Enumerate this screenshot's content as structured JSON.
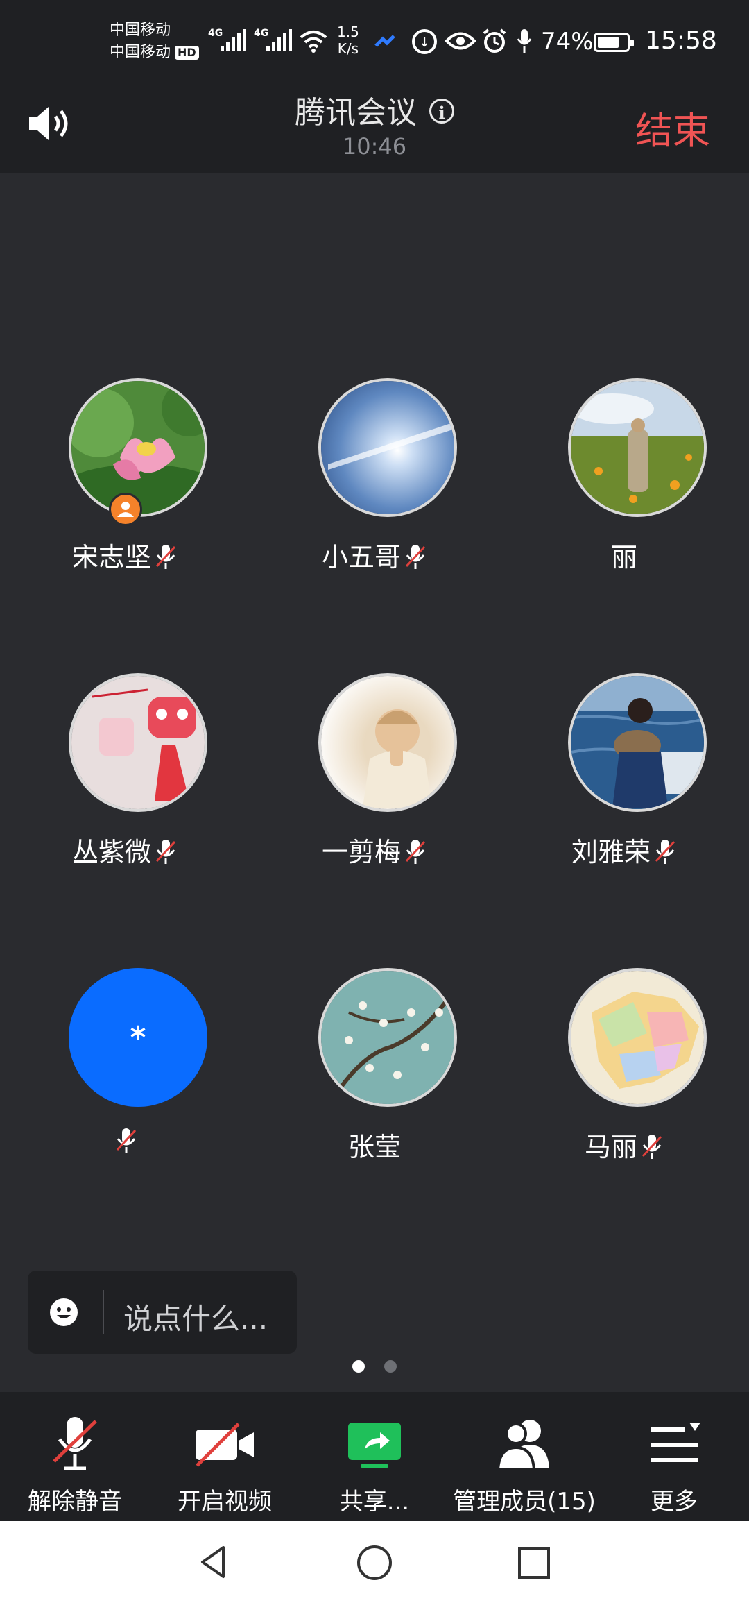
{
  "status_bar": {
    "carrier1": "中国移动",
    "carrier2": "中国移动",
    "hd_badge": "HD",
    "net1": "4G",
    "net2": "4G",
    "speed_value": "1.5",
    "speed_unit": "K/s",
    "battery_pct": "74%",
    "battery_level": 0.74,
    "time": "15:58"
  },
  "header": {
    "title": "腾讯会议",
    "info_glyph": "i",
    "timer": "10:46",
    "end_label": "结束"
  },
  "participants": [
    {
      "name": "宋志坚",
      "muted": true,
      "host": true,
      "avatar": "pink-lotus-photo"
    },
    {
      "name": "小五哥",
      "muted": true,
      "host": false,
      "avatar": "sun-sky-photo"
    },
    {
      "name": "丽",
      "muted": false,
      "host": false,
      "avatar": "flower-field-photo"
    },
    {
      "name": "丛紫微",
      "muted": true,
      "host": false,
      "avatar": "lion-ornament-photo"
    },
    {
      "name": "一剪梅",
      "muted": true,
      "host": false,
      "avatar": "praying-child-photo"
    },
    {
      "name": "刘雅荣",
      "muted": true,
      "host": false,
      "avatar": "woman-sea-photo"
    },
    {
      "name": "",
      "initial": "*",
      "muted": true,
      "host": false,
      "avatar": "blue-initial",
      "color": "#0a6cff"
    },
    {
      "name": "张莹",
      "muted": false,
      "host": false,
      "avatar": "almond-blossom-painting"
    },
    {
      "name": "马丽",
      "muted": true,
      "host": false,
      "avatar": "china-map"
    }
  ],
  "chat": {
    "placeholder": "说点什么..."
  },
  "pager": {
    "pages": 2,
    "current": 1
  },
  "toolbar": {
    "unmute": "解除静音",
    "video": "开启视频",
    "share": "共享...",
    "members": "管理成员(15)",
    "more": "更多"
  },
  "colors": {
    "background": "#2a2b2f",
    "bar": "#1f2023",
    "end_red": "#f05454",
    "share_green": "#1fc05a",
    "host_orange": "#f5822a",
    "mute_red": "#e0403c"
  }
}
